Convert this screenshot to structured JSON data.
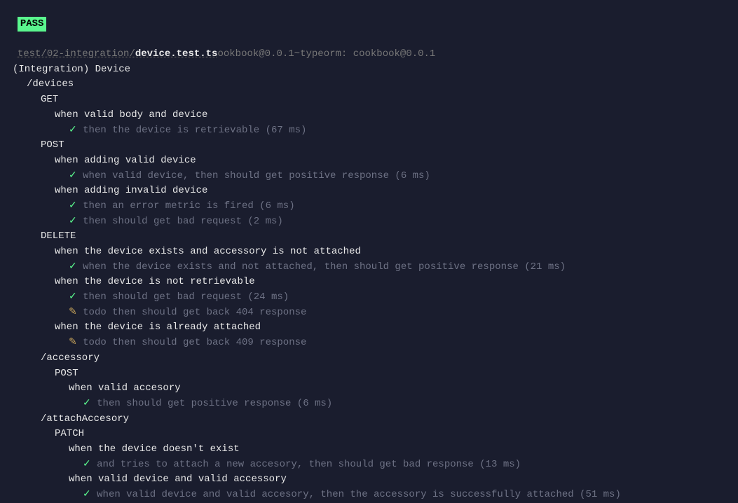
{
  "header": {
    "badge": "PASS",
    "path_dir": "test/02-integration/",
    "path_file": "device.test.ts",
    "trail": "ookbook@0.0.1~typeorm: cookbook@0.0.1"
  },
  "suite": "(Integration) Device",
  "lines": [
    {
      "indent": 2,
      "kind": "route",
      "text": "/devices"
    },
    {
      "indent": 3,
      "kind": "method",
      "text": "GET"
    },
    {
      "indent": 4,
      "kind": "context",
      "text": "when valid body and device"
    },
    {
      "indent": 5,
      "kind": "pass",
      "text": "then the device is retrievable (67 ms)"
    },
    {
      "indent": 3,
      "kind": "method",
      "text": "POST"
    },
    {
      "indent": 4,
      "kind": "context",
      "text": "when adding valid device"
    },
    {
      "indent": 5,
      "kind": "pass",
      "text": "when valid device, then should get positive response (6 ms)"
    },
    {
      "indent": 4,
      "kind": "context",
      "text": "when adding invalid device"
    },
    {
      "indent": 5,
      "kind": "pass",
      "text": "then an error metric is fired (6 ms)"
    },
    {
      "indent": 5,
      "kind": "pass",
      "text": "then should get bad request (2 ms)"
    },
    {
      "indent": 3,
      "kind": "method",
      "text": "DELETE"
    },
    {
      "indent": 4,
      "kind": "context",
      "text": "when the device exists and accessory is not attached"
    },
    {
      "indent": 5,
      "kind": "pass",
      "text": "when the device exists and not attached, then should get positive response (21 ms)"
    },
    {
      "indent": 4,
      "kind": "context",
      "text": "when the device is not retrievable"
    },
    {
      "indent": 5,
      "kind": "pass",
      "text": "then should get bad request (24 ms)"
    },
    {
      "indent": 5,
      "kind": "todo",
      "text": "todo then should get back 404 response"
    },
    {
      "indent": 4,
      "kind": "context",
      "text": "when the device is already attached"
    },
    {
      "indent": 5,
      "kind": "todo",
      "text": "todo then should get back 409 response"
    },
    {
      "indent": 3,
      "kind": "route",
      "text": "/accessory"
    },
    {
      "indent": 4,
      "kind": "method",
      "text": "POST"
    },
    {
      "indent": 5,
      "kind": "context",
      "text": "when valid accesory"
    },
    {
      "indent": 6,
      "kind": "pass",
      "text": "then should get positive response (6 ms)"
    },
    {
      "indent": 3,
      "kind": "route",
      "text": "/attachAccesory"
    },
    {
      "indent": 4,
      "kind": "method",
      "text": "PATCH"
    },
    {
      "indent": 5,
      "kind": "context",
      "text": "when the device doesn't exist"
    },
    {
      "indent": 6,
      "kind": "pass",
      "text": "and tries to attach a new accesory, then should get bad response (13 ms)"
    },
    {
      "indent": 5,
      "kind": "context",
      "text": "when valid device and valid accessory"
    },
    {
      "indent": 6,
      "kind": "pass",
      "text": "when valid device and valid accesory, then the accessory is successfully attached (51 ms)"
    }
  ],
  "icons": {
    "check": "✓",
    "pencil": "✎"
  }
}
